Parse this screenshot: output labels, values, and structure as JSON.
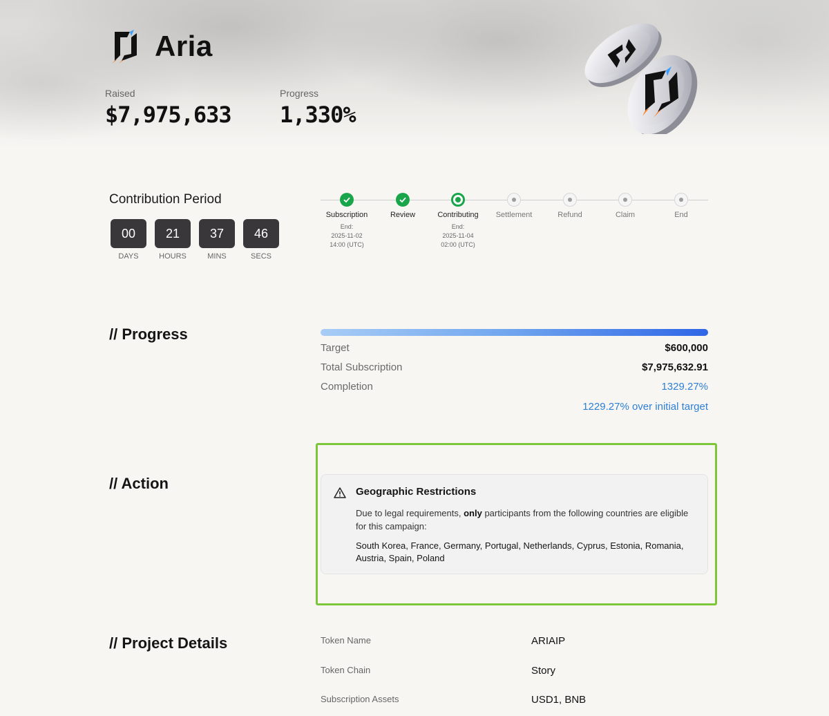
{
  "project": {
    "name": "Aria",
    "raised_label": "Raised",
    "raised_value": "$7,975,633",
    "progress_label": "Progress",
    "progress_value": "1,330%"
  },
  "contribution": {
    "title": "Contribution Period",
    "timer": [
      {
        "value": "00",
        "unit": "DAYS"
      },
      {
        "value": "21",
        "unit": "HOURS"
      },
      {
        "value": "37",
        "unit": "MINS"
      },
      {
        "value": "46",
        "unit": "SECS"
      }
    ],
    "steps": [
      {
        "name": "Subscription",
        "status": "done",
        "end_label": "End:",
        "date": "2025-11-02",
        "time": "14:00 (UTC)"
      },
      {
        "name": "Review",
        "status": "done"
      },
      {
        "name": "Contributing",
        "status": "active",
        "end_label": "End:",
        "date": "2025-11-04",
        "time": "02:00 (UTC)"
      },
      {
        "name": "Settlement",
        "status": "pending"
      },
      {
        "name": "Refund",
        "status": "pending"
      },
      {
        "name": "Claim",
        "status": "pending"
      },
      {
        "name": "End",
        "status": "pending"
      }
    ]
  },
  "progress": {
    "title": "// Progress",
    "bar_fill_percent": 100,
    "target_label": "Target",
    "target_value": "$600,000",
    "total_label": "Total Subscription",
    "total_value": "$7,975,632.91",
    "completion_label": "Completion",
    "completion_value": "1329.27%",
    "over_note": "1229.27% over initial target"
  },
  "action": {
    "title": "// Action",
    "geo": {
      "title": "Geographic Restrictions",
      "desc_before": "Due to legal requirements, ",
      "desc_bold": "only",
      "desc_after": " participants from the following countries are eligible for this campaign:",
      "countries": "South Korea, France, Germany, Portugal, Netherlands, Cyprus, Estonia, Romania, Austria, Spain, Poland"
    }
  },
  "details": {
    "title": "// Project Details",
    "rows": [
      {
        "label": "Token Name",
        "value": "ARIAIP"
      },
      {
        "label": "Token Chain",
        "value": "Story"
      },
      {
        "label": "Subscription Assets",
        "value": "USD1, BNB"
      }
    ]
  },
  "colors": {
    "accent_green": "#19a64a",
    "link_blue": "#2e7fd6",
    "highlight_frame": "#7dc63a"
  }
}
